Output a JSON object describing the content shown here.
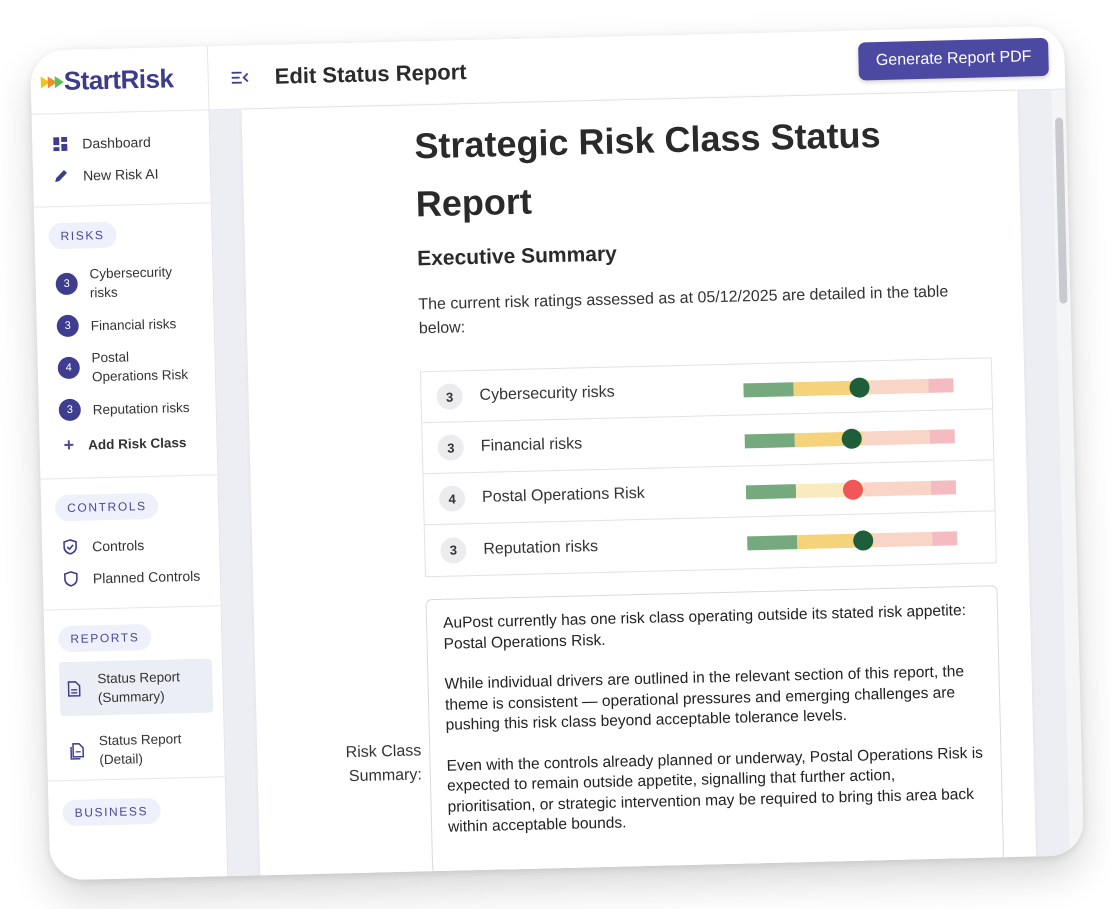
{
  "app": {
    "logo_text": "StartRisk",
    "page_title": "Edit Status Report",
    "generate_button": "Generate Report PDF",
    "accent_color": "#4b49a2"
  },
  "sidebar": {
    "nav": [
      {
        "label": "Dashboard",
        "icon": "dashboard-icon"
      },
      {
        "label": "New Risk AI",
        "icon": "pencil-icon"
      }
    ],
    "risks_heading": "RISKS",
    "risks": [
      {
        "rating": "3",
        "label": "Cybersecurity risks"
      },
      {
        "rating": "3",
        "label": "Financial risks"
      },
      {
        "rating": "4",
        "label": "Postal Operations Risk"
      },
      {
        "rating": "3",
        "label": "Reputation risks"
      }
    ],
    "add_risk_label": "Add Risk Class",
    "controls_heading": "CONTROLS",
    "controls": [
      {
        "label": "Controls",
        "icon": "shield-check-icon"
      },
      {
        "label": "Planned Controls",
        "icon": "shield-icon"
      }
    ],
    "reports_heading": "REPORTS",
    "reports": [
      {
        "label": "Status Report (Summary)",
        "icon": "document-icon",
        "active": true
      },
      {
        "label": "Status Report (Detail)",
        "icon": "documents-icon",
        "active": false
      }
    ],
    "business_heading": "BUSINESS"
  },
  "report": {
    "title": "Strategic Risk Class Status Report",
    "section_heading": "Executive Summary",
    "intro": "The current risk ratings assessed as at 05/12/2025 are detailed in the table below:",
    "risk_rows": [
      {
        "rating": "3",
        "label": "Cybersecurity risks",
        "level": 0.55,
        "knob_color": "#1f5e3a"
      },
      {
        "rating": "3",
        "label": "Financial risks",
        "level": 0.51,
        "knob_color": "#1f5e3a"
      },
      {
        "rating": "4",
        "label": "Postal Operations Risk",
        "level": 0.51,
        "knob_color": "#f25757"
      },
      {
        "rating": "3",
        "label": "Reputation risks",
        "level": 0.55,
        "knob_color": "#1f5e3a"
      }
    ],
    "summary_label": "Risk Class Summary:",
    "summary_paragraphs": [
      "AuPost currently has one risk class operating outside its stated risk appetite: Postal Operations Risk.",
      "While individual drivers are outlined in the relevant section of this report, the theme is consistent — operational pressures and emerging challenges are pushing this risk class beyond acceptable tolerance levels.",
      "Even with the controls already planned or underway, Postal Operations Risk is expected to remain outside appetite, signalling that further action, prioritisation, or strategic intervention may be required to bring this area back within acceptable bounds."
    ]
  },
  "gauge_colors": {
    "green": "#76a97d",
    "yellow": "#f5d37a",
    "pale_yellow": "#faeac0",
    "peach": "#f8d5c6",
    "pink": "#f4bcc0"
  }
}
